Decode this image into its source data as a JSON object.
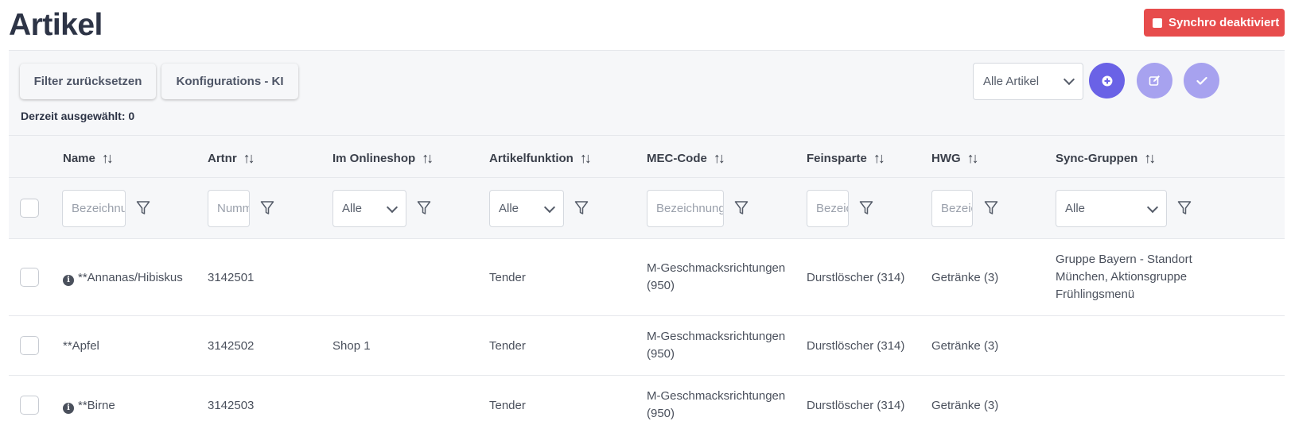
{
  "page": {
    "title": "Artikel"
  },
  "sync_button": {
    "label": "Synchro deaktiviert",
    "color": "#e74c4c"
  },
  "toolbar": {
    "filter_reset_label": "Filter zurücksetzen",
    "config_label": "Konfigurations - KI",
    "selected_info": "Derzeit ausgewählt: 0",
    "view_select_value": "Alle Artikel",
    "add_icon": "plus-circle-icon",
    "edit_icon": "edit-icon",
    "check_icon": "check-icon",
    "accent": "#6a62e6"
  },
  "columns": [
    {
      "label": "Name"
    },
    {
      "label": "Artnr"
    },
    {
      "label": "Im Onlineshop"
    },
    {
      "label": "Artikelfunktion"
    },
    {
      "label": "MEC-Code"
    },
    {
      "label": "Feinsparte"
    },
    {
      "label": "HWG"
    },
    {
      "label": "Sync-Gruppen"
    }
  ],
  "filters": {
    "name_placeholder": "Bezeichnung",
    "artnr_placeholder": "Nummer",
    "onlineshop_value": "Alle",
    "artikelfunktion_value": "Alle",
    "mec_placeholder": "Bezeichnung",
    "feinsparte_placeholder": "Bezeichnung",
    "hwg_placeholder": "Bezeichnung",
    "syncgruppen_value": "Alle"
  },
  "rows": [
    {
      "info": true,
      "name": "**Annanas/Hibiskus",
      "artnr": "3142501",
      "onlineshop": "",
      "funktion": "Tender",
      "mec_line1": "M-Geschmacksrichtungen",
      "mec_line2": "(950)",
      "feinsparte": "Durstlöscher (314)",
      "hwg": "Getränke (3)",
      "sync_line1": "Gruppe Bayern - Standort",
      "sync_line2": "München, Aktionsgruppe",
      "sync_line3": "Frühlingsmenü"
    },
    {
      "info": false,
      "name": "**Apfel",
      "artnr": "3142502",
      "onlineshop": "Shop 1",
      "funktion": "Tender",
      "mec_line1": "M-Geschmacksrichtungen",
      "mec_line2": "(950)",
      "feinsparte": "Durstlöscher (314)",
      "hwg": "Getränke (3)",
      "sync_line1": "",
      "sync_line2": "",
      "sync_line3": ""
    },
    {
      "info": true,
      "name": "**Birne",
      "artnr": "3142503",
      "onlineshop": "",
      "funktion": "Tender",
      "mec_line1": "M-Geschmacksrichtungen",
      "mec_line2": "(950)",
      "feinsparte": "Durstlöscher (314)",
      "hwg": "Getränke (3)",
      "sync_line1": "",
      "sync_line2": "",
      "sync_line3": ""
    }
  ]
}
